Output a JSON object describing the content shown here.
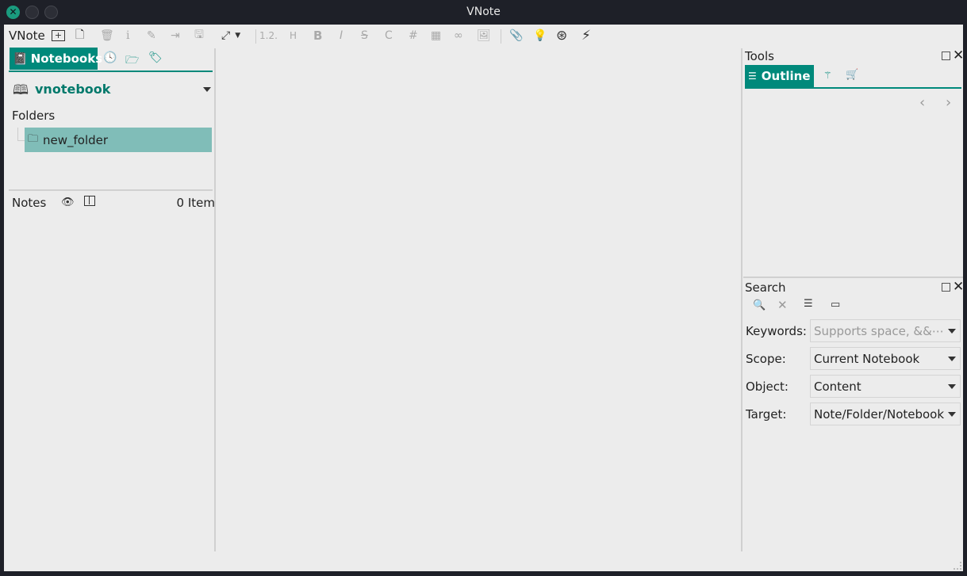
{
  "window": {
    "title": "VNote"
  },
  "toolbar": {
    "app_label": "VNote",
    "items": [
      {
        "name": "new-notebook",
        "icon": "folder-plus-icon"
      },
      {
        "name": "new-note",
        "icon": "file-plus-icon"
      },
      {
        "name": "delete",
        "icon": "trash-icon"
      },
      {
        "name": "info",
        "icon": "info-icon"
      },
      {
        "name": "edit",
        "icon": "edit-icon"
      },
      {
        "name": "exit-edit",
        "icon": "exit-icon"
      },
      {
        "name": "save",
        "icon": "save-icon"
      },
      {
        "name": "expand",
        "icon": "expand-icon"
      }
    ],
    "format": {
      "numbered": "1.2.",
      "heading": "H",
      "bold": "B",
      "italic": "I",
      "strike": "S",
      "code": "C",
      "hash": "#"
    }
  },
  "left": {
    "tabs": [
      {
        "label": "Notebooks"
      },
      {
        "icon": "history-icon"
      },
      {
        "icon": "explorer-icon"
      },
      {
        "icon": "tag-icon"
      }
    ],
    "notebook": "vnotebook",
    "folders_label": "Folders",
    "folders": [
      {
        "name": "new_folder"
      }
    ],
    "notes_label": "Notes",
    "notes_count": "0 Item"
  },
  "tools": {
    "title": "Tools",
    "tabs": [
      {
        "label": "Outline"
      },
      {
        "icon": "magic-wand-icon"
      },
      {
        "icon": "cart-icon"
      }
    ]
  },
  "search": {
    "title": "Search",
    "keywords_label": "Keywords:",
    "keywords_placeholder": "Supports space, &&⋯",
    "scope_label": "Scope:",
    "scope_value": "Current Notebook",
    "object_label": "Object:",
    "object_value": "Content",
    "target_label": "Target:",
    "target_value": "Note/Folder/Notebook"
  },
  "colors": {
    "accent": "#00897b",
    "selection": "#80bdb8"
  }
}
